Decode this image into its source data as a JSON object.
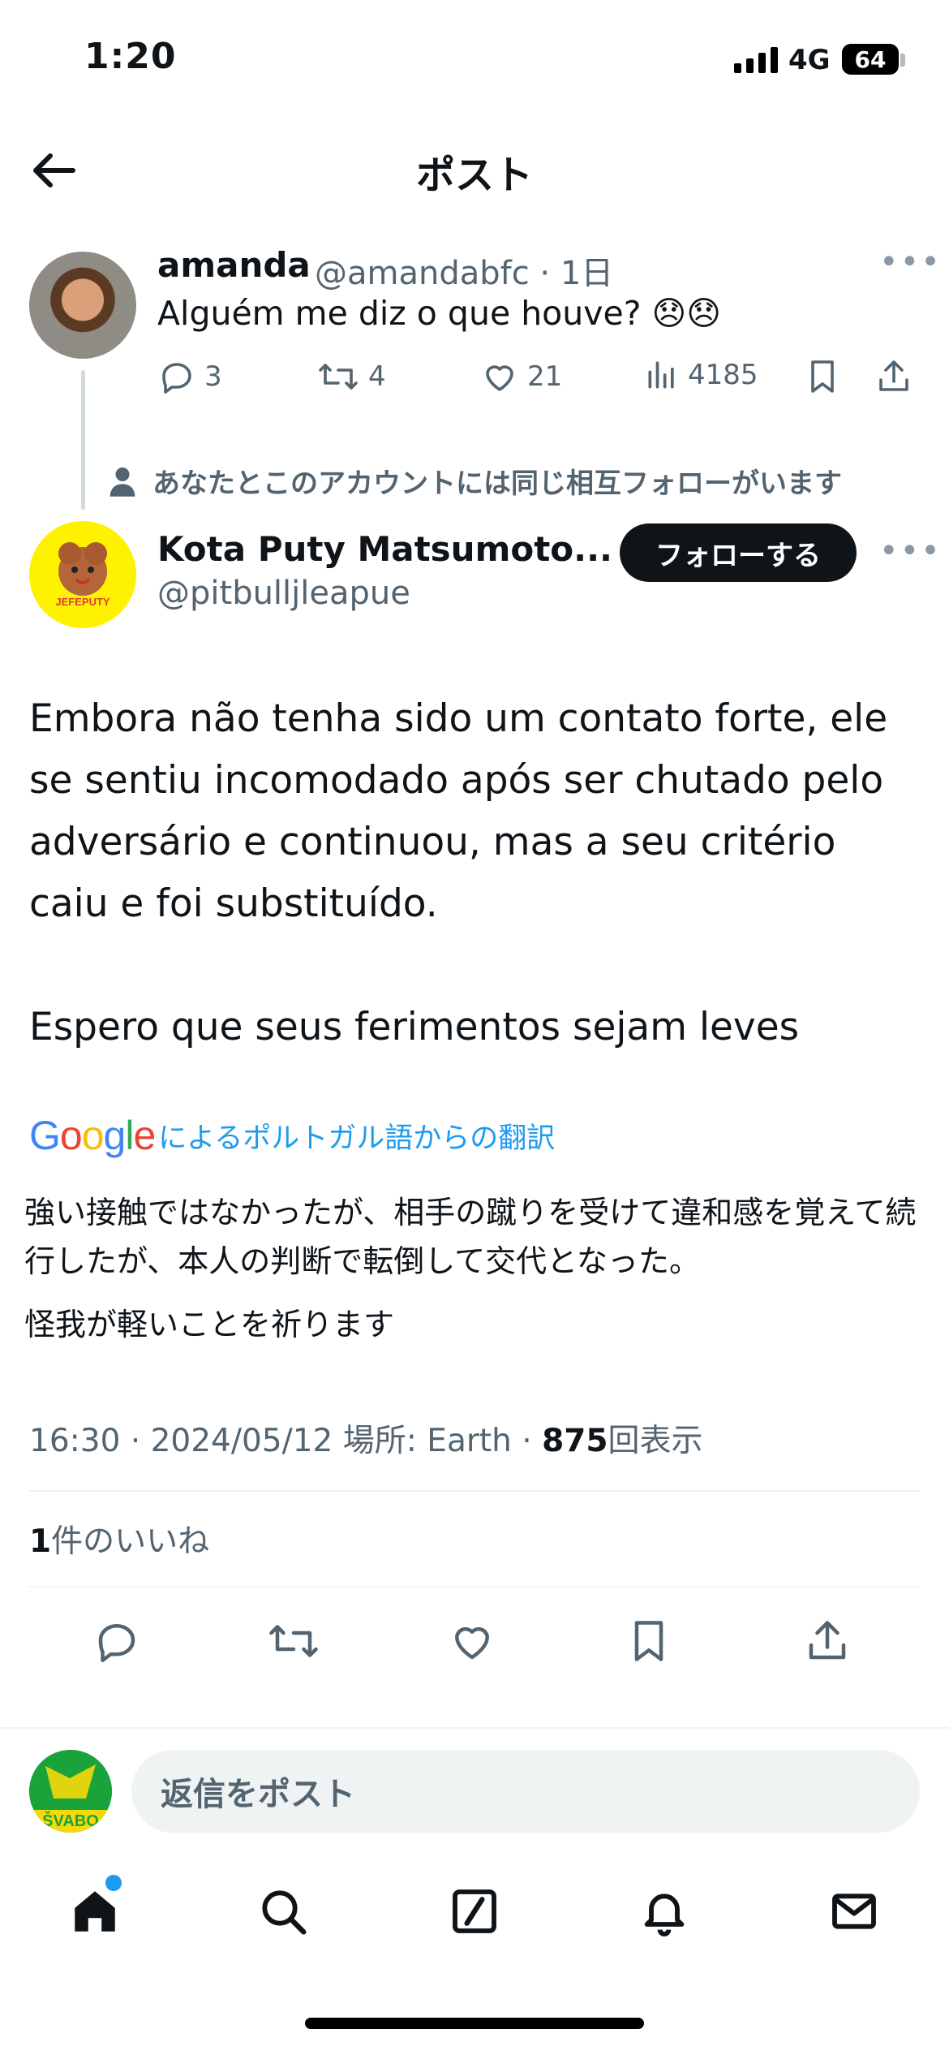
{
  "status_bar": {
    "time": "1:20",
    "network": "4G",
    "battery": "64"
  },
  "header": {
    "title": "ポスト"
  },
  "tweet_parent": {
    "name": "amanda",
    "handle_time": "@amandabfc · 1日",
    "text": "Alguém me diz o que houve? 😞😞",
    "replies": "3",
    "retweets": "4",
    "likes": "21",
    "views": "4185"
  },
  "mutual_notice": "あなたとこのアカウントには同じ相互フォローがいます",
  "tweet_main": {
    "name": "Kota Puty Matsumoto...",
    "handle": "@pitbulljleapue",
    "follow_label": "フォローする",
    "avatar_text": "JEFEPUTY",
    "body": "Embora não tenha sido um contato forte, ele se sentiu incomodado após ser chutado pelo adversário e continuou, mas a seu critério caiu e foi substituído.\n\nEspero que seus ferimentos sejam leves",
    "translation_label": "によるポルトガル語からの翻訳",
    "translation_brand": "Google",
    "translated_p1": "強い接触ではなかったが、相手の蹴りを受けて違和感を覚えて続行したが、本人の判断で転倒して交代となった。",
    "translated_p2": "怪我が軽いことを祈ります",
    "meta_prefix": "16:30 · 2024/05/12 場所: Earth · ",
    "meta_views": "875",
    "meta_views_suffix": "回表示",
    "likes_count": "1",
    "likes_suffix": "件のいいね"
  },
  "reply": {
    "placeholder": "返信をポスト",
    "avatar_text": "ŠVABO"
  },
  "colors": {
    "accent": "#1d9bf0",
    "text": "#0f1419",
    "secondary": "#536471",
    "divider": "#eff3f4"
  },
  "tabs": [
    "home-icon",
    "search-icon",
    "grok-icon",
    "notifications-icon",
    "messages-icon"
  ]
}
